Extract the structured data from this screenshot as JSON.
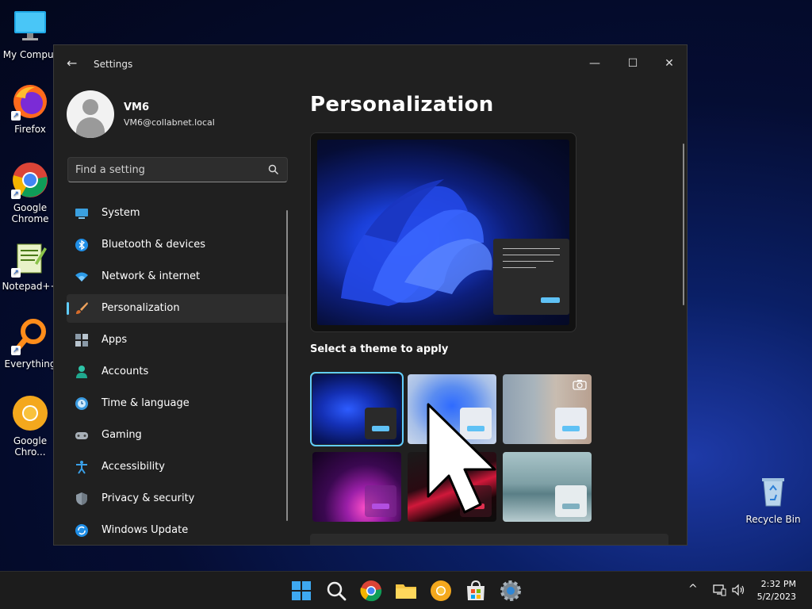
{
  "desktop": {
    "icons": [
      {
        "label": "My Comput",
        "icon": "computer-icon"
      },
      {
        "label": "Firefox",
        "icon": "firefox-icon"
      },
      {
        "label": "Google Chrome",
        "icon": "chrome-icon"
      },
      {
        "label": "Notepad++",
        "icon": "notepad-icon"
      },
      {
        "label": "Everything",
        "icon": "everything-icon"
      },
      {
        "label": "Google Chro...",
        "icon": "chrome-canary-icon"
      },
      {
        "label": "Recycle Bin",
        "icon": "recycle-bin-icon"
      }
    ]
  },
  "window": {
    "title": "Settings",
    "back_icon": "←",
    "minimize_icon": "—",
    "maximize_icon": "☐",
    "close_icon": "✕"
  },
  "profile": {
    "name": "VM6",
    "email": "VM6@collabnet.local"
  },
  "search": {
    "placeholder": "Find a setting"
  },
  "nav": {
    "items": [
      {
        "label": "System",
        "icon": "system-icon"
      },
      {
        "label": "Bluetooth & devices",
        "icon": "bluetooth-icon"
      },
      {
        "label": "Network & internet",
        "icon": "wifi-icon"
      },
      {
        "label": "Personalization",
        "icon": "brush-icon",
        "active": true
      },
      {
        "label": "Apps",
        "icon": "apps-icon"
      },
      {
        "label": "Accounts",
        "icon": "accounts-icon"
      },
      {
        "label": "Time & language",
        "icon": "clock-icon"
      },
      {
        "label": "Gaming",
        "icon": "gamepad-icon"
      },
      {
        "label": "Accessibility",
        "icon": "accessibility-icon"
      },
      {
        "label": "Privacy & security",
        "icon": "shield-icon"
      },
      {
        "label": "Windows Update",
        "icon": "update-icon"
      }
    ]
  },
  "main": {
    "title": "Personalization",
    "themes_label": "Select a theme to apply"
  },
  "colors": {
    "accent": "#60cdff",
    "window_bg": "#202020",
    "pane_bg": "#2d2d2d"
  },
  "taskbar": {
    "time": "2:32 PM",
    "date": "5/2/2023",
    "tray_chevron": "^"
  }
}
